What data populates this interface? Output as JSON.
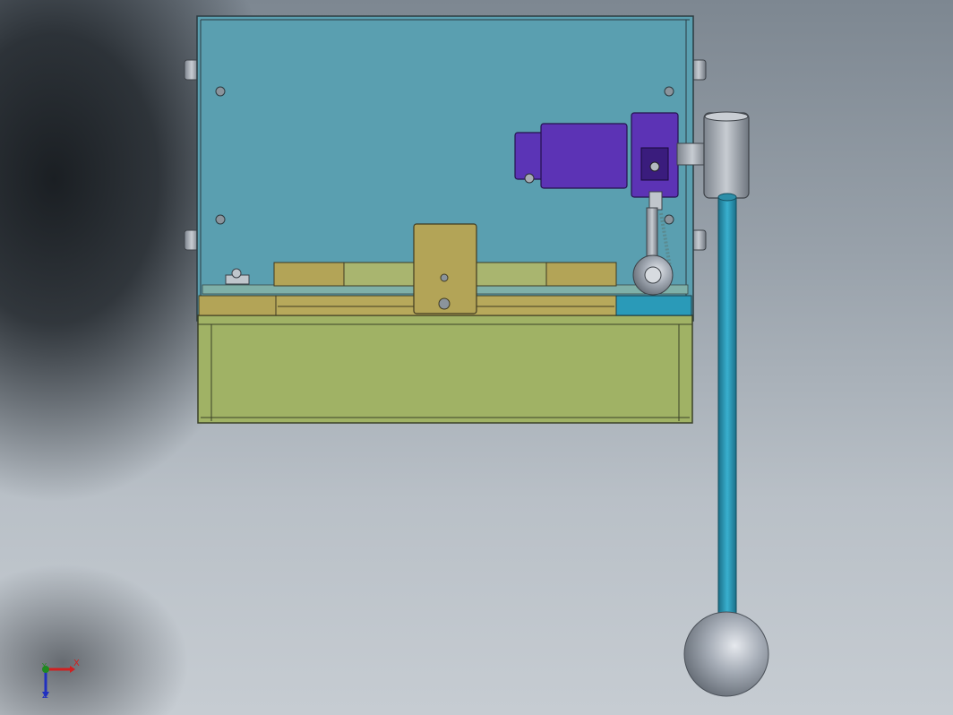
{
  "viewport": {
    "view": "front",
    "background": "gradient-gray"
  },
  "colors": {
    "enclosure_panel": "#5a9fb0",
    "base_tray": "#a0b265",
    "slider_parts": "#b3a457",
    "motor": "#5c33b5",
    "lever_rod": "#2a98b6",
    "metal": "#9aa2ac"
  },
  "model": {
    "parts": [
      "enclosure-panel",
      "base-tray",
      "slide-rail",
      "carriage-block",
      "motor",
      "motor-bracket",
      "drive-link",
      "pivot-hub",
      "lever-rod",
      "lever-knob"
    ]
  },
  "triad": {
    "x_label": "X",
    "y_label": "Y",
    "z_label": "Z"
  }
}
